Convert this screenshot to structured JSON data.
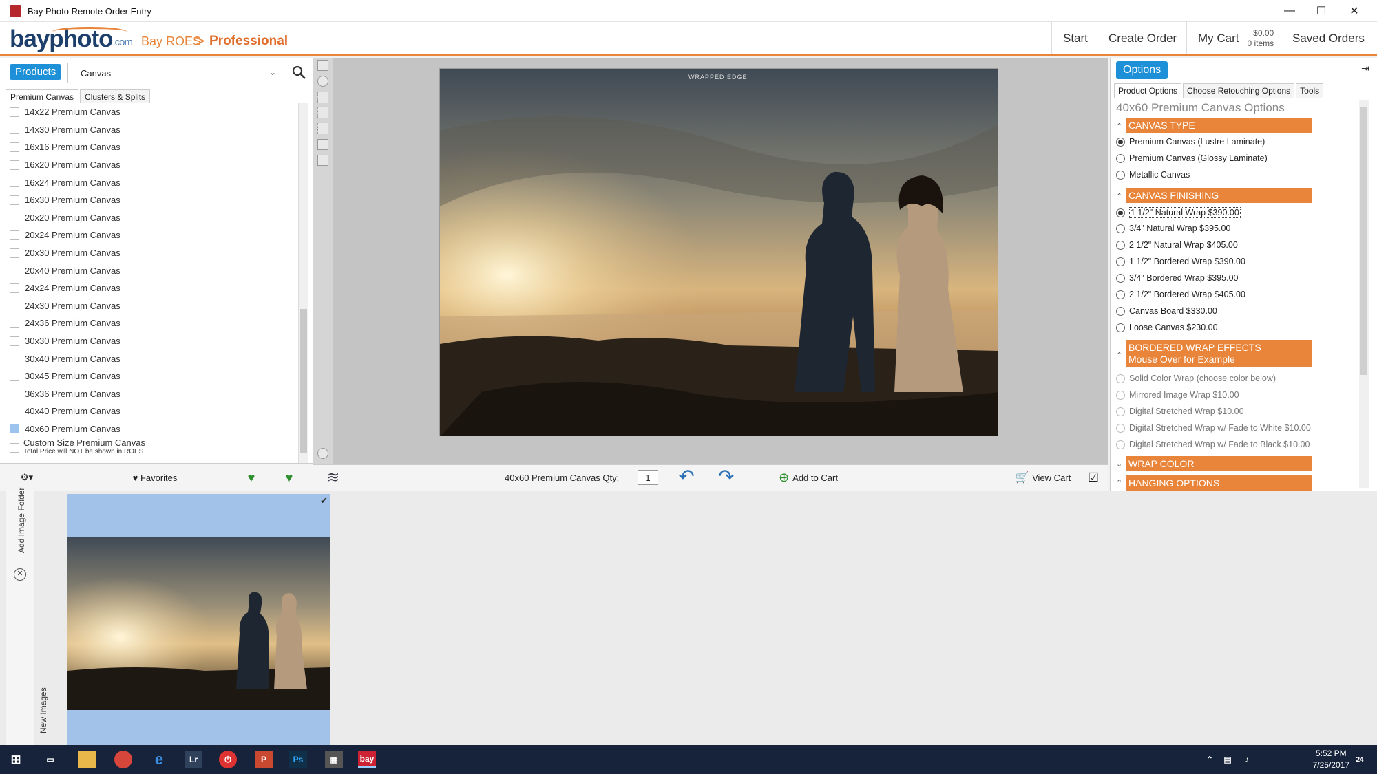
{
  "window": {
    "title": "Bay Photo Remote Order Entry",
    "minimize": "—",
    "maximize": "☐",
    "close": "✕"
  },
  "header": {
    "logo": {
      "main": "bayphoto",
      "suffix": ".com"
    },
    "breadcrumb": {
      "root": "Bay ROES",
      "separator": ">",
      "current": "Professional"
    },
    "nav": {
      "start": "Start",
      "create_order": "Create Order",
      "my_cart": "My Cart",
      "cart_amount": "$0.00",
      "cart_items": "0 items",
      "saved_orders": "Saved Orders"
    }
  },
  "left": {
    "tab_label": "Products",
    "category_select": "Canvas",
    "subtabs": [
      "Premium Canvas",
      "Clusters & Splits"
    ],
    "products": [
      "14x22 Premium Canvas",
      "14x30 Premium Canvas",
      "16x16 Premium Canvas",
      "16x20 Premium Canvas",
      "16x24 Premium Canvas",
      "16x30 Premium Canvas",
      "20x20 Premium Canvas",
      "20x24 Premium Canvas",
      "20x30 Premium Canvas",
      "20x40 Premium Canvas",
      "24x24 Premium Canvas",
      "24x30 Premium Canvas",
      "24x36 Premium Canvas",
      "30x30 Premium Canvas",
      "30x40 Premium Canvas",
      "30x45 Premium Canvas",
      "36x36 Premium Canvas",
      "40x40 Premium Canvas",
      "40x60 Premium Canvas"
    ],
    "selected_product": "40x60 Premium Canvas",
    "custom": {
      "label": "Custom Size Premium Canvas",
      "note": "Total Price will NOT be shown in ROES"
    },
    "toolbar": {
      "favorites": "Favorites"
    }
  },
  "canvas": {
    "wrap_label": "WRAPPED EDGE"
  },
  "bottom_bar": {
    "qty_label": "40x60 Premium Canvas Qty:",
    "qty_value": "1",
    "add_to_cart": "Add to Cart",
    "view_cart": "View Cart"
  },
  "right": {
    "tab_label": "Options",
    "tabs": [
      "Product Options",
      "Choose Retouching Options",
      "Tools"
    ],
    "options_title": "40x60 Premium Canvas Options",
    "canvas_type": {
      "title": "CANVAS TYPE",
      "options": [
        "Premium Canvas (Lustre Laminate)",
        "Premium Canvas (Glossy Laminate)",
        "Metallic Canvas"
      ],
      "selected": 0
    },
    "canvas_finishing": {
      "title": "CANVAS FINISHING",
      "options": [
        "1 1/2\" Natural Wrap $390.00",
        "3/4\" Natural Wrap $395.00",
        "2 1/2\" Natural Wrap $405.00",
        "1 1/2\" Bordered Wrap $390.00",
        "3/4\" Bordered Wrap $395.00",
        "2 1/2\" Bordered Wrap $405.00",
        "Canvas Board $330.00",
        "Loose Canvas $230.00"
      ],
      "selected": 0
    },
    "bordered_effects": {
      "title": "BORDERED WRAP EFFECTS",
      "subtitle": "Mouse Over for Example",
      "options": [
        "Solid Color Wrap (choose color below)",
        "Mirrored Image Wrap $10.00",
        "Digital Stretched Wrap $10.00",
        "Digital Stretched Wrap w/ Fade to White $10.00",
        "Digital Stretched Wrap w/ Fade to Black $10.00"
      ]
    },
    "wrap_color": {
      "title": "WRAP COLOR"
    },
    "hanging_options": {
      "title": "HANGING OPTIONS"
    }
  },
  "filmstrip": {
    "add_image_folder": "Add Image Folder",
    "new_images": "New Images"
  },
  "taskbar": {
    "time": "5:52 PM",
    "date": "7/25/2017",
    "notif_count": "24"
  },
  "colors": {
    "accent_orange": "#e9853a",
    "accent_blue": "#1e90d8",
    "taskbar": "#16233a"
  }
}
